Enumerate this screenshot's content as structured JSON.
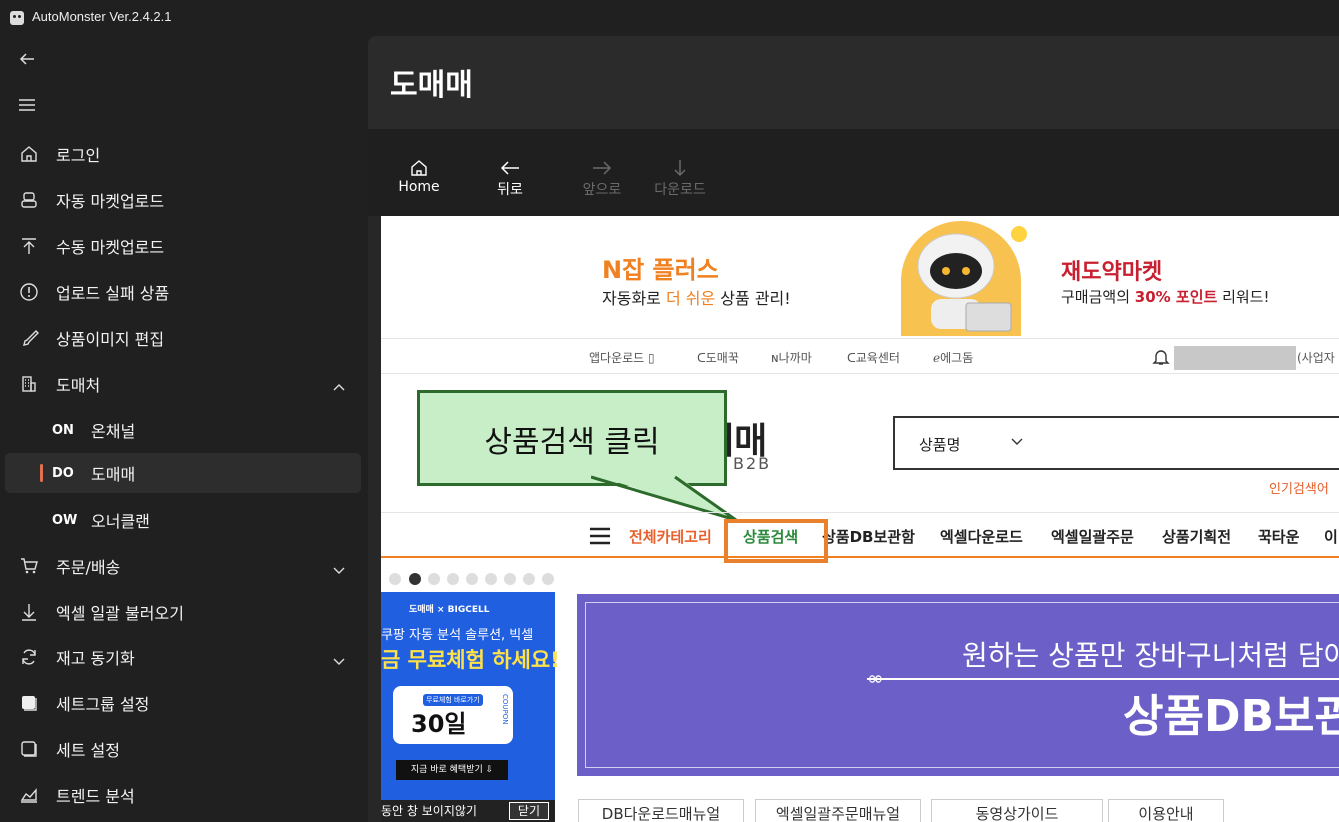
{
  "window": {
    "title": "AutoMonster Ver.2.4.2.1"
  },
  "sidebar": {
    "items": [
      {
        "label": "로그인",
        "icon": "home-icon"
      },
      {
        "label": "자동 마켓업로드",
        "icon": "robot-icon"
      },
      {
        "label": "수동 마켓업로드",
        "icon": "upload-icon"
      },
      {
        "label": "업로드 실패 상품",
        "icon": "alert-circle-icon"
      },
      {
        "label": "상품이미지 편집",
        "icon": "brush-icon"
      },
      {
        "label": "도매처",
        "icon": "building-icon"
      },
      {
        "label": "주문/배송",
        "icon": "cart-icon"
      },
      {
        "label": "엑셀 일괄 불러오기",
        "icon": "download-icon"
      },
      {
        "label": "재고 동기화",
        "icon": "sync-icon"
      },
      {
        "label": "세트그룹 설정",
        "icon": "square-filled-icon"
      },
      {
        "label": "세트 설정",
        "icon": "square-outline-icon"
      },
      {
        "label": "트렌드 분석",
        "icon": "chart-area-icon"
      }
    ],
    "subitems": [
      {
        "code": "ON",
        "label": "온채널"
      },
      {
        "code": "DO",
        "label": "도매매"
      },
      {
        "code": "OW",
        "label": "오너클랜"
      }
    ],
    "accent": "#e07050"
  },
  "page": {
    "title": "도매매"
  },
  "toolbar": {
    "home": "Home",
    "back": "뒤로",
    "forward": "앞으로",
    "download": "다운로드"
  },
  "web": {
    "banner": {
      "nzap_title": "N잡 플러스",
      "nzap_sub_pre": "자동화로 ",
      "nzap_sub_hl": "더 쉬운",
      "nzap_sub_post": " 상품 관리!",
      "jaedo_title": "재도약마켓",
      "jaedo_sub_pre": "구매금액의 ",
      "jaedo_sub_hl": "30% 포인트",
      "jaedo_sub_post": " 리워드!"
    },
    "topbar": {
      "links": [
        "앱다운로드",
        "도매꾹",
        "나까마",
        "교육센터",
        "에그돔"
      ],
      "business": "(사업자"
    },
    "logo": {
      "text": "매매",
      "sub": "B2B"
    },
    "search": {
      "category": "상품명"
    },
    "popular": "인기검색어",
    "callout": "상품검색 클릭",
    "categories": [
      "전체카테고리",
      "상품검색",
      "상품DB보관함",
      "엑셀다운로드",
      "엑셀일괄주문",
      "상품기획전",
      "꾹타운",
      "이"
    ],
    "ad_left": {
      "brand": "도매매 × BIGCELL",
      "line1": "쿠팡 자동 분석 솔루션, 빅셀",
      "line2": "금 무료체험 하세요!",
      "coupon_tag": "무료체험 바로가기",
      "coupon_days": "30일",
      "coupon_side": "COUPON",
      "button": "지금 바로 혜택받기 ⇩",
      "bottom": "동안 창 보이지않기",
      "close": "닫기"
    },
    "ad_main": {
      "line1": "원하는 상품만 장바구니처럼 담아",
      "line2": "상품DB보관"
    },
    "buttons": [
      "DB다운로드매뉴얼",
      "엑셀일괄주문매뉴얼",
      "동영상가이드",
      "이용안내"
    ]
  }
}
